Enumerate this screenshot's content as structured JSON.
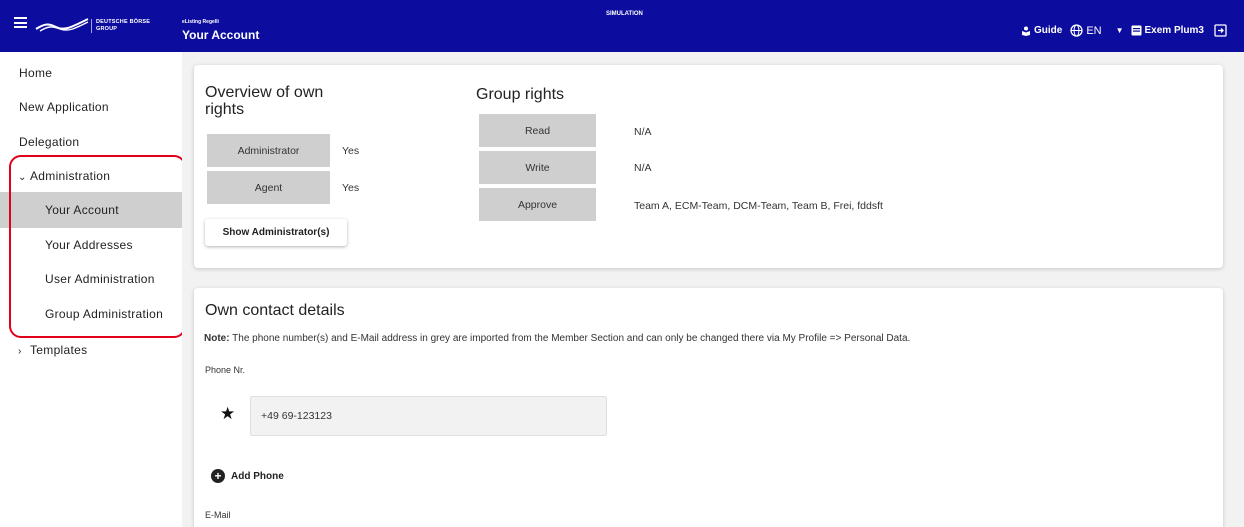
{
  "topbar": {
    "logo_line1": "DEUTSCHE BÖRSE",
    "logo_line2": "GROUP",
    "app_subtitle": "eListing Regelli",
    "page_title": "Your Account",
    "environment": "SIMULATION",
    "guide_label": "Guide",
    "language": "EN",
    "user_name": "Exem Plum3"
  },
  "sidebar": {
    "items": [
      {
        "label": "Home"
      },
      {
        "label": "New Application"
      },
      {
        "label": "Delegation"
      },
      {
        "label": "Administration",
        "chevron": "⌄"
      },
      {
        "label": "Your Account"
      },
      {
        "label": "Your Addresses"
      },
      {
        "label": "User Administration"
      },
      {
        "label": "Group Administration"
      },
      {
        "label": "Templates",
        "chevron": "›"
      }
    ]
  },
  "own_rights": {
    "title": "Overview of own rights",
    "rows": [
      {
        "label": "Administrator",
        "value": "Yes"
      },
      {
        "label": "Agent",
        "value": "Yes"
      }
    ],
    "show_admin_button": "Show Administrator(s)"
  },
  "group_rights": {
    "title": "Group rights",
    "rows": [
      {
        "label": "Read",
        "value": "N/A"
      },
      {
        "label": "Write",
        "value": "N/A"
      },
      {
        "label": "Approve",
        "value": "Team A, ECM-Team, DCM-Team, Team B, Frei, fddsft"
      }
    ]
  },
  "contact": {
    "title": "Own contact details",
    "note_bold": "Note:",
    "note_text": " The phone number(s) and E-Mail address in grey are imported from the Member Section and can only be changed there via My Profile => Personal Data.",
    "phone_label": "Phone Nr.",
    "phone_value": "+49 69-123123",
    "add_phone": "Add Phone",
    "email_label": "E-Mail"
  },
  "colors": {
    "topbar": "#0c0c9e",
    "highlight": "#e3001b",
    "active_nav": "#cfcfcf"
  }
}
